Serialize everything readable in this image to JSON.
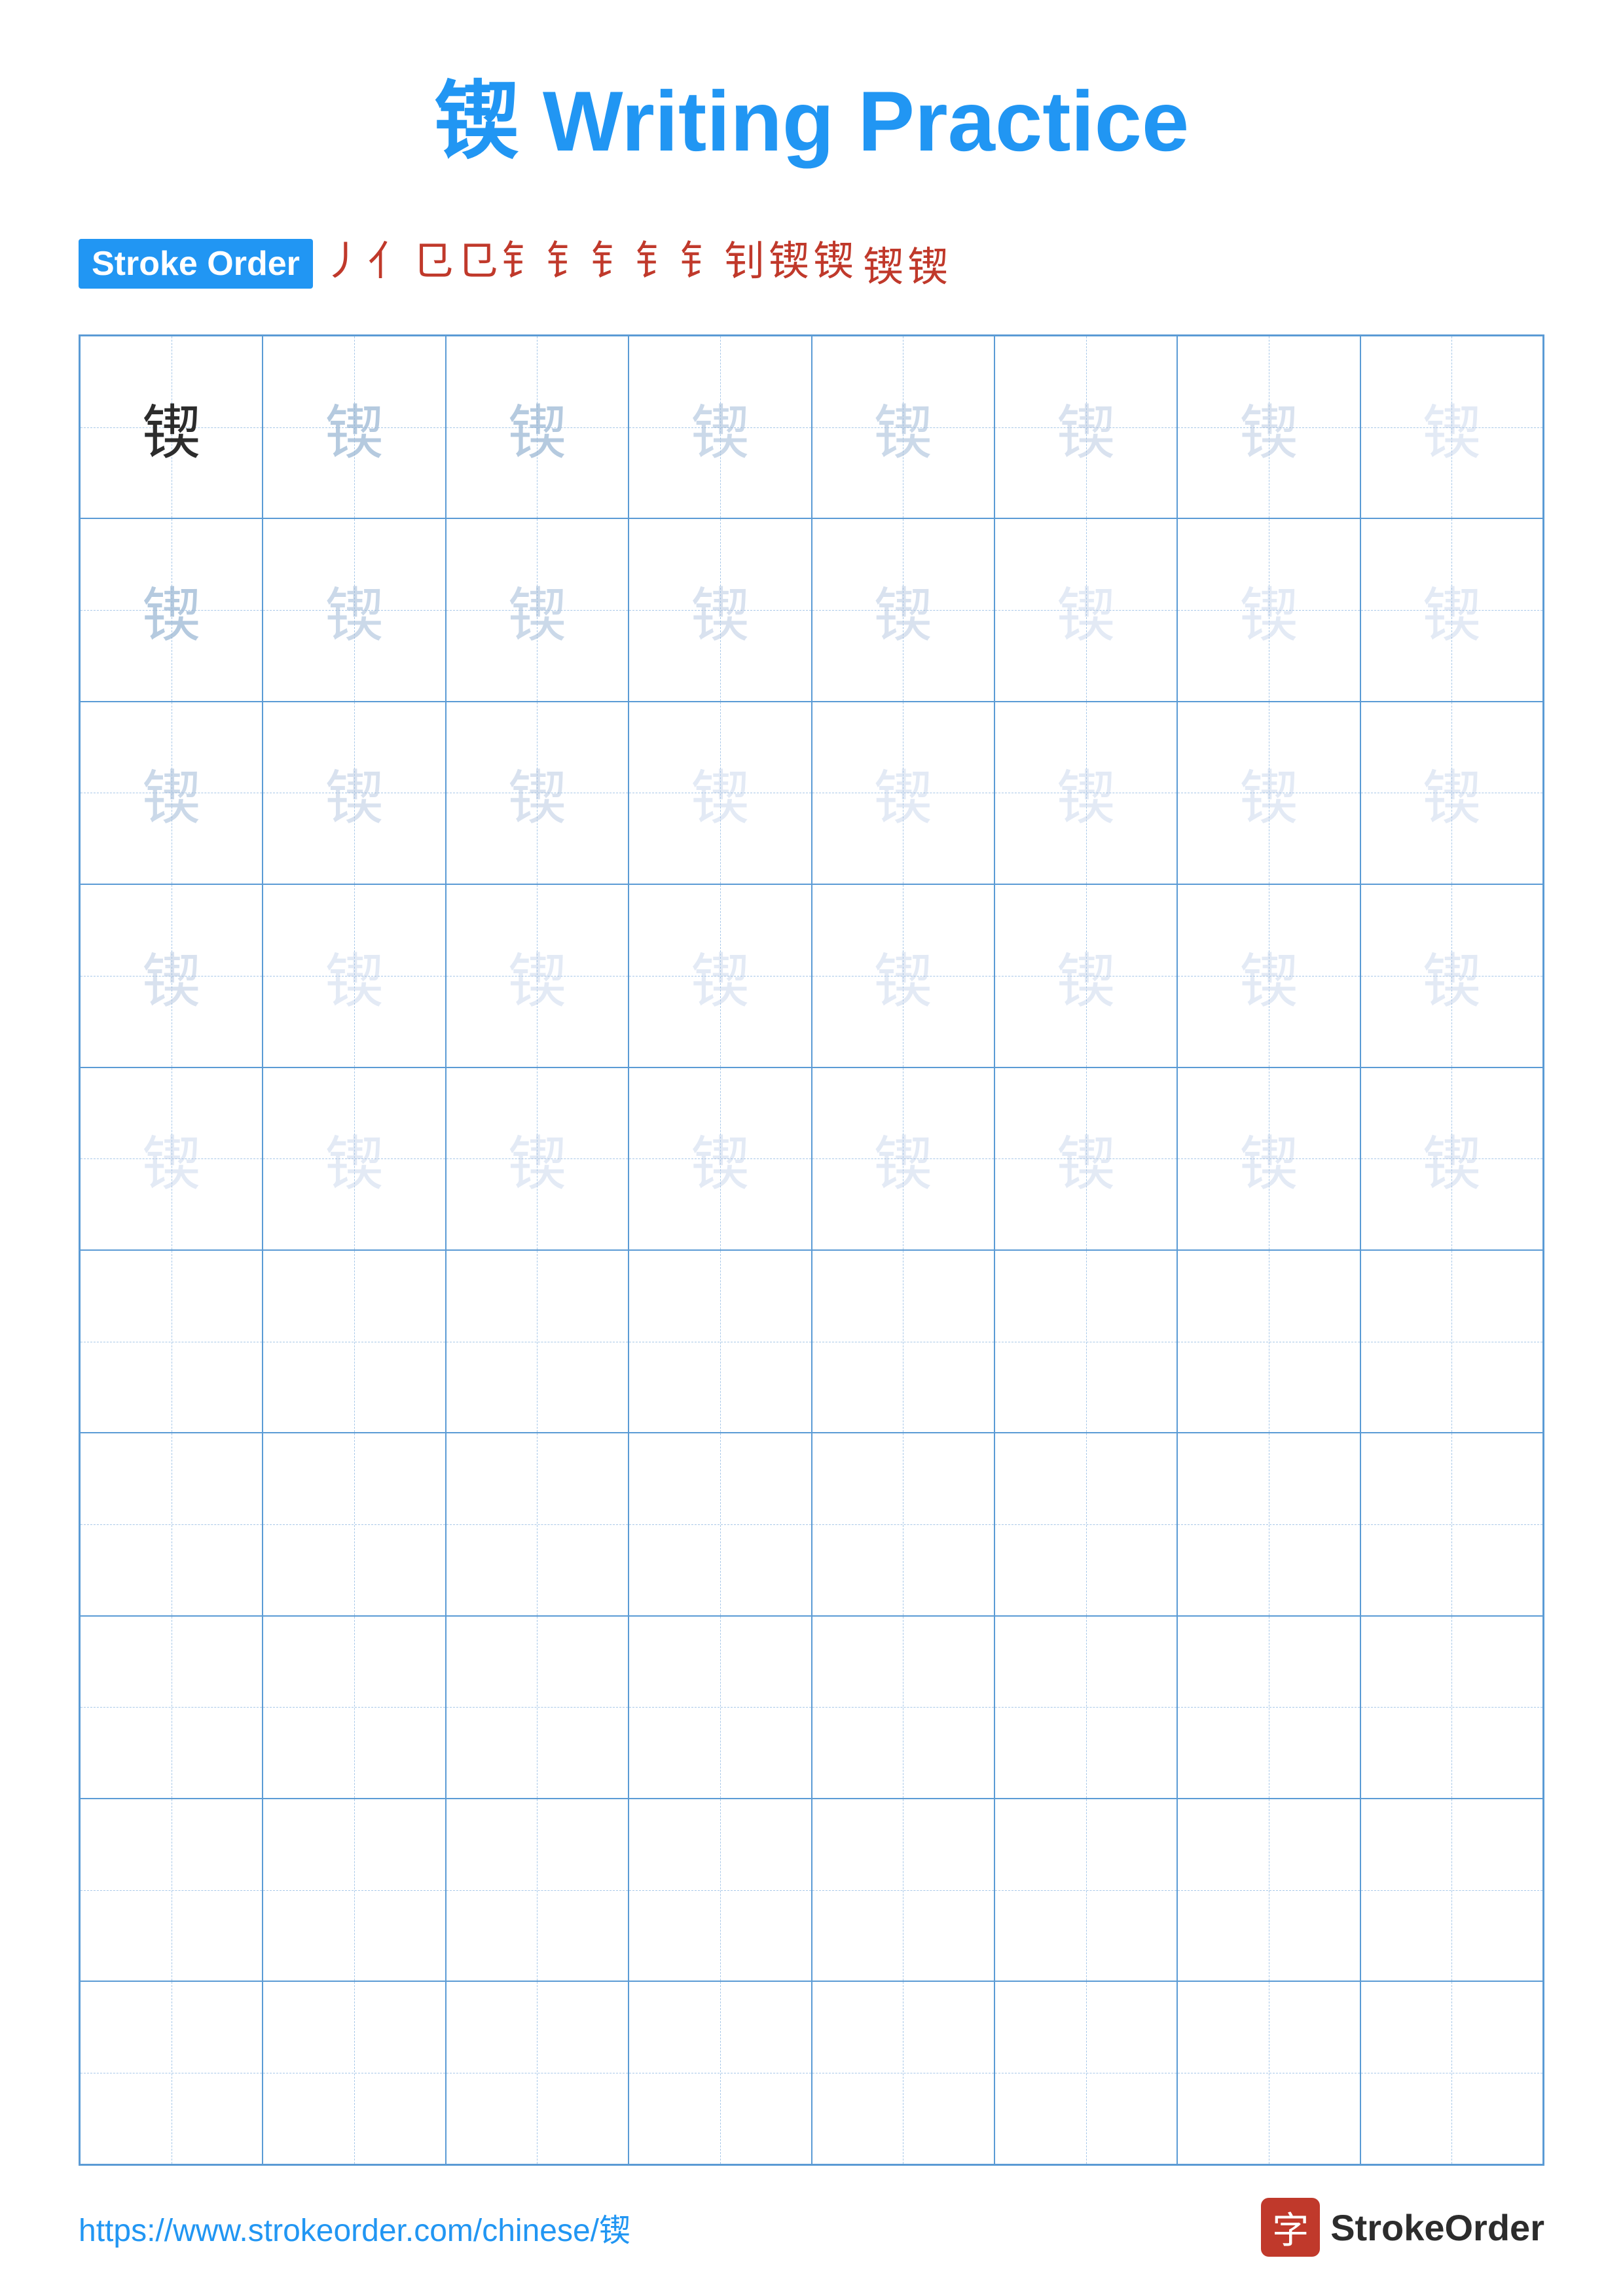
{
  "title": {
    "char": "锲",
    "text": "Writing Practice",
    "full": "锲 Writing Practice"
  },
  "stroke_order": {
    "label": "Stroke Order",
    "strokes": [
      "㇒",
      "㇓",
      "㇕",
      "㇑",
      "钅",
      "钅",
      "钅",
      "钅",
      "钅",
      "钊",
      "钊锲",
      "钊锲"
    ],
    "stroke_chars": [
      "丿",
      "亻",
      "㔾",
      "㔾",
      "钅",
      "钅",
      "钅",
      "钅",
      "钅",
      "钊",
      "锲",
      "锲"
    ],
    "sequence": [
      "㇒",
      "㇓",
      "㇕",
      "㇑",
      "钅̃",
      "钅̃",
      "钅̃",
      "钅̃",
      "钅̃",
      "钊",
      "锲",
      "锲"
    ],
    "display": [
      "丿",
      "亻",
      "㔾",
      "㔾",
      "钅",
      "钅",
      "钅",
      "钅",
      "钅",
      "钊",
      "锲",
      "锲"
    ],
    "line1": [
      "丿",
      "亻",
      "㔾",
      "㔾",
      "钅",
      "钅",
      "钅",
      "钅",
      "钅",
      "钊",
      "锲"
    ],
    "line2": [
      "锲",
      "锲"
    ]
  },
  "practice": {
    "character": "锲",
    "rows": 10,
    "cols": 8,
    "fade_levels": [
      [
        0,
        1,
        1,
        2,
        2,
        3,
        3,
        4
      ],
      [
        1,
        2,
        2,
        3,
        3,
        4,
        4,
        4
      ],
      [
        2,
        3,
        3,
        4,
        4,
        4,
        4,
        4
      ],
      [
        3,
        4,
        4,
        4,
        4,
        4,
        4,
        4
      ],
      [
        4,
        4,
        4,
        4,
        4,
        4,
        4,
        4
      ],
      [
        -1,
        -1,
        -1,
        -1,
        -1,
        -1,
        -1,
        -1
      ],
      [
        -1,
        -1,
        -1,
        -1,
        -1,
        -1,
        -1,
        -1
      ],
      [
        -1,
        -1,
        -1,
        -1,
        -1,
        -1,
        -1,
        -1
      ],
      [
        -1,
        -1,
        -1,
        -1,
        -1,
        -1,
        -1,
        -1
      ],
      [
        -1,
        -1,
        -1,
        -1,
        -1,
        -1,
        -1,
        -1
      ]
    ]
  },
  "footer": {
    "url": "https://www.strokeorder.com/chinese/锲",
    "logo_char": "字",
    "logo_text": "StrokeOrder"
  }
}
